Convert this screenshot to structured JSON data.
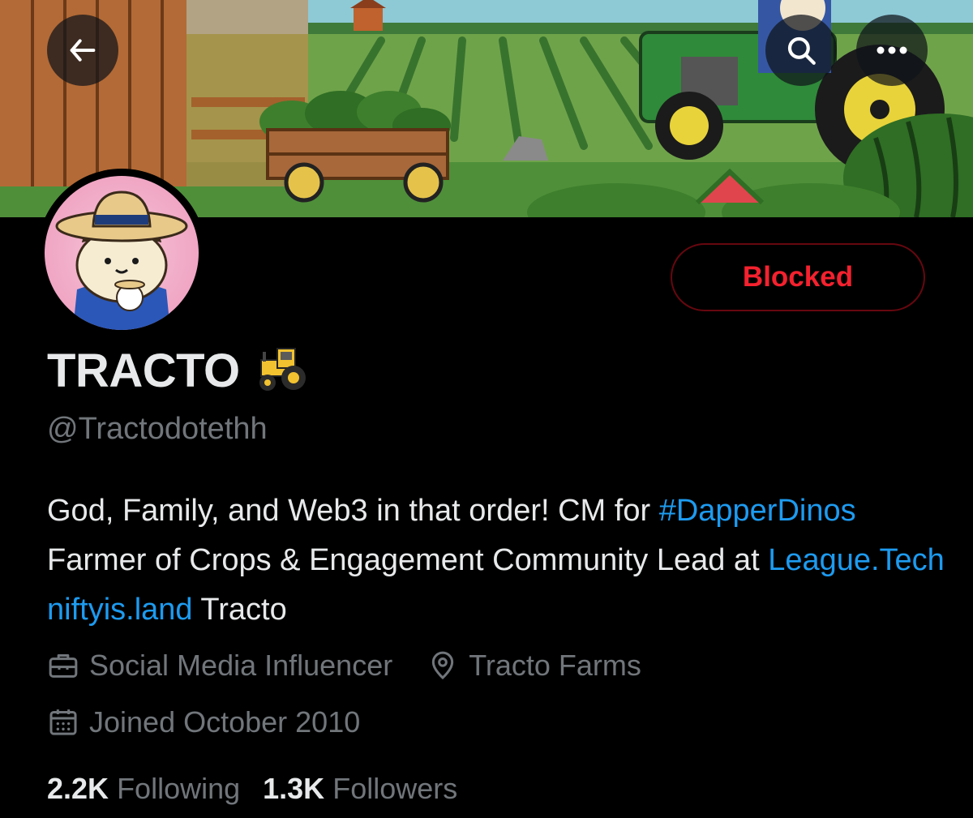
{
  "banner": {
    "description_icon": "farm-field-illustration"
  },
  "header": {
    "back_icon": "arrow-left-icon",
    "search_icon": "search-icon",
    "more_icon": "more-horizontal-icon"
  },
  "profile": {
    "display_name": "TRACTO",
    "name_emoji": "🚜",
    "handle": "@Tractodotethh",
    "block_button_label": "Blocked",
    "bio": {
      "text_1": "God, Family, and Web3 in that order! CM for ",
      "hashtag": "#DapperDinos",
      "text_2": " Farmer of Crops & Engagement Community Lead at ",
      "link_1": "League.Tech",
      "text_3": " ",
      "link_2": "niftyis.land",
      "text_4": " Tracto"
    },
    "category": "Social Media Influencer",
    "location": "Tracto Farms",
    "joined": "Joined October 2010",
    "following_count": "2.2K",
    "following_label": "Following",
    "followers_count": "1.3K",
    "followers_label": "Followers"
  },
  "colors": {
    "accent_link": "#1d9bf0",
    "blocked_red": "#f4212e",
    "secondary_text": "#71767b"
  }
}
